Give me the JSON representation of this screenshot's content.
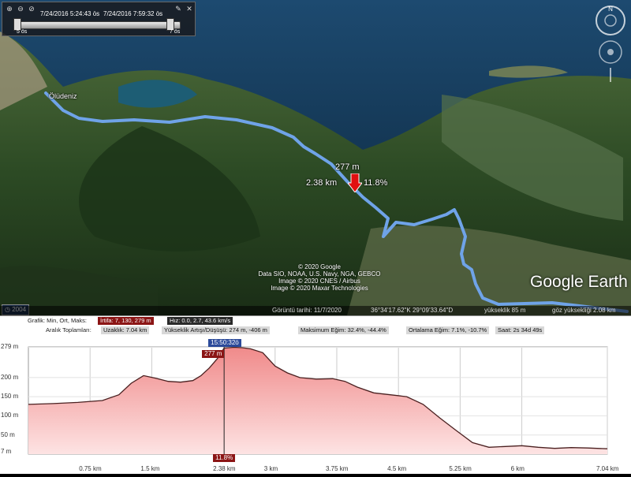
{
  "timebar": {
    "start_label": "7/24/2016 5:24:43 ös",
    "end_label": "7/24/2016 7:59:32 ös",
    "left_small": "5 ös",
    "right_small": "7 ös",
    "icons": [
      "zoom-in-icon",
      "zoom-out-icon",
      "settings-icon",
      "close-icon"
    ]
  },
  "map": {
    "place_label": "Ölüdeniz",
    "marker_elevation": "277 m",
    "marker_distance": "2.38 km",
    "marker_grade": "11.8%",
    "attribution": [
      "© 2020 Google",
      "Data SIO, NOAA, U.S. Navy, NGA, GEBCO",
      "Image © 2020 CNES / Airbus",
      "Image © 2020 Maxar Technologies"
    ],
    "logo": "Google Earth",
    "year_badge": "2004",
    "route_color": "#6fa3e8"
  },
  "statusbar": {
    "date": "Görüntü tarihi: 11/7/2020",
    "coords": "36°34'17.62\"K  29°09'33.64\"D",
    "elev": "yükseklik  85 m",
    "eye": "göz yüksekliği  2.08 km"
  },
  "stats": {
    "graph_label": "Grafik: Min, Ort, Maks:",
    "elevation_range": "İrtifa: 7, 130, 279 m",
    "speed_range": "Hız: 0.0, 2.7, 43.6 km/s",
    "total_label": "Aralık Toplamları:",
    "distance": "Uzaklık: 7.04 km",
    "gain_loss": "Yükseklik Artışı/Düşüşü: 274 m, -406 m",
    "max_grade": "Maksimum Eğim: 32.4%, -44.4%",
    "avg_grade": "Ortalama Eğim: 7.1%, -10.7%",
    "time": "Saat: 2s 34d 49s"
  },
  "chart_data": {
    "type": "area",
    "xlabel": "",
    "ylabel": "",
    "x_ticks": [
      "0.75 km",
      "1.5 km",
      "2.38 km",
      "3 km",
      "3.75 km",
      "4.5 km",
      "5.25 km",
      "6 km",
      "7.04 km"
    ],
    "y_ticks": [
      "279 m",
      "200 m",
      "150 m",
      "100 m",
      "50 m",
      "7 m"
    ],
    "xlim": [
      0,
      7.04
    ],
    "ylim": [
      0,
      280
    ],
    "cursor": {
      "x": 2.38,
      "elevation_label": "277 m",
      "grade_label": "11.8%",
      "time_label": "15:50:32ö"
    },
    "series": [
      {
        "x": [
          0,
          0.3,
          0.6,
          0.9,
          1.1,
          1.25,
          1.4,
          1.55,
          1.7,
          1.85,
          2.0,
          2.1,
          2.2,
          2.3,
          2.38,
          2.5,
          2.6,
          2.7,
          2.85,
          3.0,
          3.15,
          3.3,
          3.5,
          3.7,
          3.85,
          4.0,
          4.2,
          4.4,
          4.6,
          4.8,
          5.0,
          5.2,
          5.4,
          5.6,
          5.8,
          6.0,
          6.2,
          6.4,
          6.6,
          6.8,
          7.04
        ],
        "y": [
          130,
          132,
          135,
          140,
          155,
          185,
          205,
          198,
          190,
          188,
          192,
          205,
          225,
          250,
          277,
          279,
          278,
          275,
          265,
          230,
          212,
          200,
          196,
          197,
          190,
          175,
          160,
          155,
          150,
          130,
          95,
          62,
          30,
          18,
          20,
          22,
          18,
          15,
          17,
          16,
          14
        ]
      }
    ]
  }
}
